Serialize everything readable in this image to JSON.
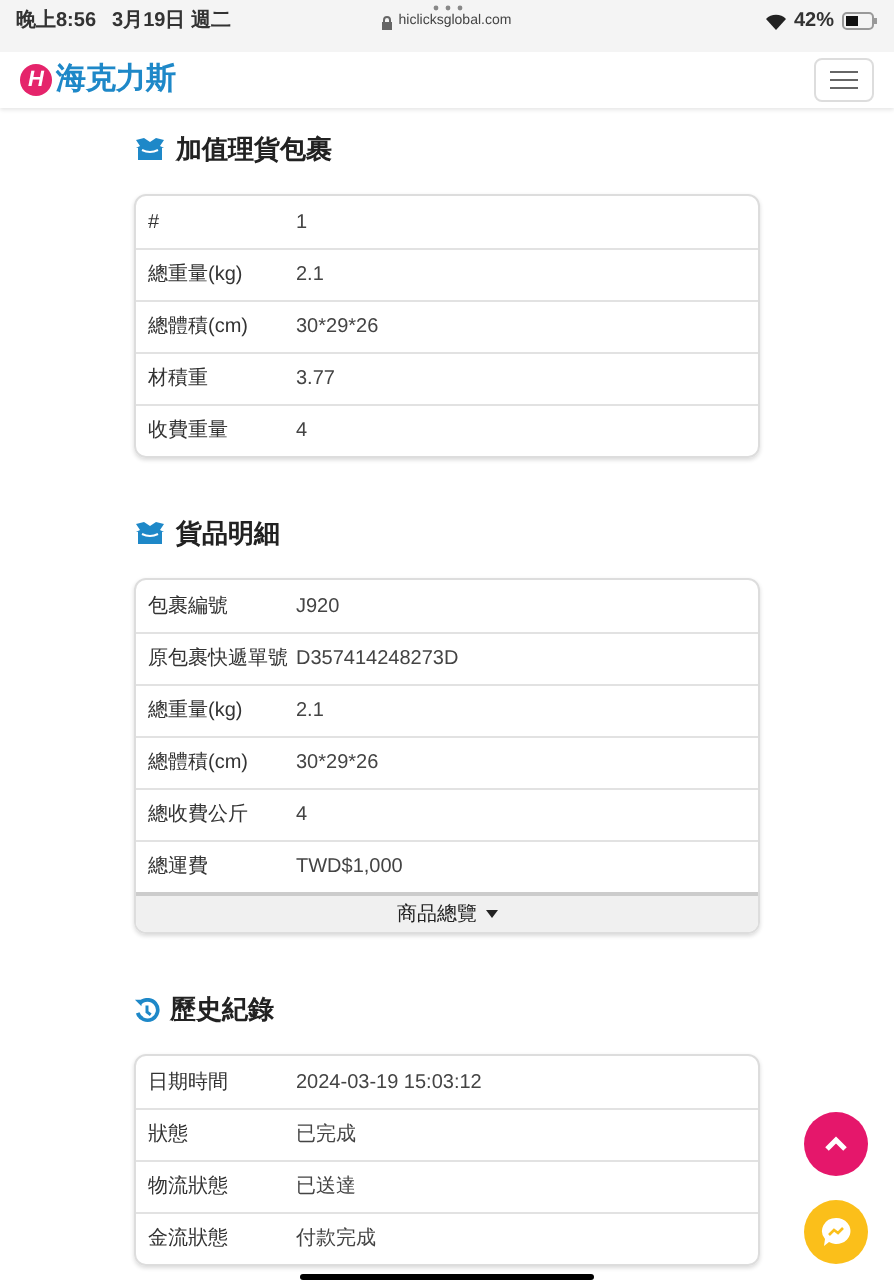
{
  "status_bar": {
    "time": "晚上8:56",
    "date": "3月19日 週二",
    "url": "hiclicksglobal.com",
    "battery": "42%"
  },
  "navbar": {
    "logo_mark": "H",
    "logo_text": "海克力斯"
  },
  "sections": [
    {
      "kind": "box",
      "title": "加值理貨包裹",
      "rows": [
        {
          "label": "#",
          "value": "1"
        },
        {
          "label": "總重量(kg)",
          "value": "2.1"
        },
        {
          "label": "總體積(cm)",
          "value": "30*29*26"
        },
        {
          "label": "材積重",
          "value": "3.77"
        },
        {
          "label": "收費重量",
          "value": "4"
        }
      ]
    },
    {
      "kind": "box",
      "title": "貨品明細",
      "rows": [
        {
          "label": "包裹編號",
          "value": "J920"
        },
        {
          "label": "原包裹快遞單號",
          "value": "D357414248273D"
        },
        {
          "label": "總重量(kg)",
          "value": "2.1"
        },
        {
          "label": "總體積(cm)",
          "value": "30*29*26"
        },
        {
          "label": "總收費公斤",
          "value": "4"
        },
        {
          "label": "總運費",
          "value": "TWD$1,000"
        }
      ],
      "footer_button": "商品總覽"
    },
    {
      "kind": "history",
      "title": "歷史紀錄",
      "rows": [
        {
          "label": "日期時間",
          "value": "2024-03-19 15:03:12"
        },
        {
          "label": "狀態",
          "value": "已完成"
        },
        {
          "label": "物流狀態",
          "value": "已送達"
        },
        {
          "label": "金流狀態",
          "value": "付款完成"
        }
      ]
    }
  ]
}
